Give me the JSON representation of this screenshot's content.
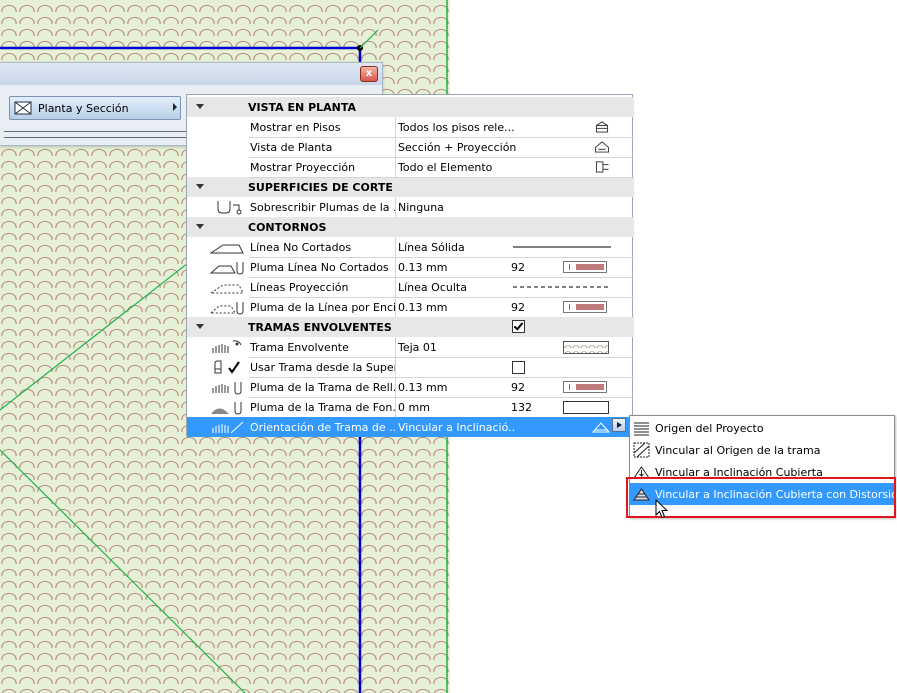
{
  "palette": {
    "close_glyph": "x",
    "panel_button_label": "Planta y Sección"
  },
  "settings": {
    "sections": [
      {
        "title": "VISTA EN PLANTA",
        "rows": [
          {
            "label": "Mostrar en Pisos",
            "value": "Todos los pisos rele...",
            "icon": "floor-stack-icon"
          },
          {
            "label": "Vista de Planta",
            "value": "Sección + Proyección",
            "icon": "roof-section-icon"
          },
          {
            "label": "Mostrar Proyección",
            "value": "Todo el Elemento",
            "icon": "projection-icon"
          }
        ]
      },
      {
        "title": "SUPERFICIES DE CORTE",
        "rows": [
          {
            "label": "Sobrescribir Plumas de la ...",
            "value": "Ninguna",
            "icon": "override-pens-icon"
          }
        ]
      },
      {
        "title": "CONTORNOS",
        "rows": [
          {
            "label": "Línea No Cortados",
            "value": "Línea Sólida",
            "icon": "uncut-line-icon",
            "right": "solid-line"
          },
          {
            "label": "Pluma Línea No Cortados",
            "value": "0.13 mm",
            "num": "92",
            "icon": "uncut-pen-icon",
            "right": "pen"
          },
          {
            "label": "Líneas Proyección",
            "value": "Línea Oculta",
            "icon": "overhead-line-icon",
            "right": "dashed-line"
          },
          {
            "label": "Pluma de la Línea por Enci...",
            "value": "0.13 mm",
            "num": "92",
            "icon": "overhead-pen-icon",
            "right": "pen"
          }
        ]
      },
      {
        "title": "TRAMAS ENVOLVENTES",
        "checked": true,
        "rows": [
          {
            "label": "Trama Envolvente",
            "value": "Teja 01",
            "icon": "cover-fill-icon",
            "right": "fill-preview"
          },
          {
            "label": "Usar Trama desde la Super...",
            "value": "",
            "icon": "use-surface-fill-icon",
            "right": "checkbox"
          },
          {
            "label": "Pluma de la Trama de Rell...",
            "value": "0.13 mm",
            "num": "92",
            "icon": "fill-pen-icon",
            "right": "pen"
          },
          {
            "label": "Pluma de la Trama de Fon...",
            "value": "0 mm",
            "num": "132",
            "icon": "background-pen-icon",
            "right": "empty-pen"
          },
          {
            "label": "Orientación de Trama de ...",
            "value": "Vincular a Inclinació...",
            "icon": "fill-orientation-icon",
            "selected": true
          }
        ]
      }
    ]
  },
  "popup": {
    "items": [
      {
        "label": "Origen del Proyecto",
        "icon": "project-origin-icon"
      },
      {
        "label": "Vincular al Origen de la trama",
        "icon": "fill-origin-icon"
      },
      {
        "label": "Vincular a Inclinación Cubierta",
        "icon": "roof-slope-icon"
      },
      {
        "label": "Vincular a Inclinación Cubierta con Distorsión",
        "icon": "roof-slope-distorted-icon",
        "selected": true
      }
    ]
  },
  "colors": {
    "selection": "#3399ff",
    "highlight_box": "#e0161c",
    "canvas_bg": "#e6f0d6",
    "tile_pattern": "#b98e83",
    "axis_blue": "#0000cc",
    "guide_green": "#22b14c"
  }
}
